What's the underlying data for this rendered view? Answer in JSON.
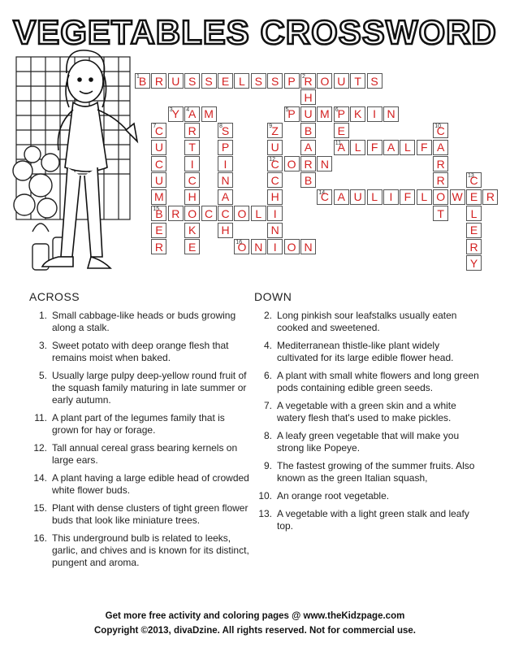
{
  "title": "VEGETABLES CROSSWORD",
  "words": [
    {
      "num": "1",
      "answer": "BRUSSELSSPROUTS",
      "row": 0,
      "col": 0,
      "dir": "across"
    },
    {
      "num": "2",
      "answer": "RHUBARB",
      "row": 0,
      "col": 10,
      "dir": "down"
    },
    {
      "num": "3",
      "answer": "YAM",
      "row": 2,
      "col": 2,
      "dir": "across"
    },
    {
      "num": "4",
      "answer": "ARTICHOKE",
      "row": 2,
      "col": 3,
      "dir": "down"
    },
    {
      "num": "5",
      "answer": "PUMPKIN",
      "row": 2,
      "col": 9,
      "dir": "across"
    },
    {
      "num": "6",
      "answer": "PEA",
      "row": 2,
      "col": 12,
      "dir": "down"
    },
    {
      "num": "7",
      "answer": "CUCUMBER",
      "row": 3,
      "col": 1,
      "dir": "down"
    },
    {
      "num": "8",
      "answer": "SPINACH",
      "row": 3,
      "col": 5,
      "dir": "down"
    },
    {
      "num": "9",
      "answer": "ZUCCHINI",
      "row": 3,
      "col": 8,
      "dir": "down"
    },
    {
      "num": "10",
      "answer": "CARROT",
      "row": 3,
      "col": 18,
      "dir": "down"
    },
    {
      "num": "11",
      "answer": "ALFALFA",
      "row": 4,
      "col": 12,
      "dir": "across"
    },
    {
      "num": "12",
      "answer": "CORN",
      "row": 5,
      "col": 8,
      "dir": "across"
    },
    {
      "num": "13",
      "answer": "CELERY",
      "row": 6,
      "col": 20,
      "dir": "down"
    },
    {
      "num": "14",
      "answer": "CAULIFLOWER",
      "row": 7,
      "col": 11,
      "dir": "across"
    },
    {
      "num": "15",
      "answer": "BROCCOLI",
      "row": 8,
      "col": 1,
      "dir": "across"
    },
    {
      "num": "16",
      "answer": "ONION",
      "row": 10,
      "col": 6,
      "dir": "across"
    }
  ],
  "across_heading": "ACROSS",
  "down_heading": "DOWN",
  "across": [
    {
      "num": "1.",
      "text": "Small cabbage-like heads or buds growing along a stalk."
    },
    {
      "num": "3.",
      "text": "Sweet potato with deep orange flesh that remains moist when baked."
    },
    {
      "num": "5.",
      "text": "Usually large pulpy deep-yellow round fruit of the squash family maturing in late summer or early autumn."
    },
    {
      "num": "11.",
      "text": "A plant part of the legumes family that is grown for hay or forage."
    },
    {
      "num": "12.",
      "text": "Tall annual cereal grass bearing kernels on large ears."
    },
    {
      "num": "14.",
      "text": "A plant having a large edible head of crowded white flower buds."
    },
    {
      "num": "15.",
      "text": "Plant with dense clusters of tight green flower buds that look like miniature trees."
    },
    {
      "num": "16.",
      "text": "This underground bulb is related to leeks, garlic, and chives and is known for its distinct, pungent and aroma."
    }
  ],
  "down": [
    {
      "num": "2.",
      "text": "Long pinkish sour leafstalks usually eaten cooked and sweetened."
    },
    {
      "num": "4.",
      "text": "Mediterranean thistle-like plant widely cultivated for its large edible flower head."
    },
    {
      "num": "6.",
      "text": "A plant with small white flowers and long green pods containing edible green seeds."
    },
    {
      "num": "7.",
      "text": "A vegetable with a green skin and a white watery flesh that's used to make pickles."
    },
    {
      "num": "8.",
      "text": "A leafy green vegetable that will make you strong like Popeye."
    },
    {
      "num": "9.",
      "text": "The fastest growing of the summer fruits. Also known as the green Italian squash,"
    },
    {
      "num": "10.",
      "text": "An orange root vegetable."
    },
    {
      "num": "13.",
      "text": "A vegetable with a light green stalk and leafy top."
    }
  ],
  "footer": {
    "line1": "Get more free activity and coloring pages @ www.theKidzpage.com",
    "line2": "Copyright ©2013, divaDzine.  All rights reserved.  Not for commercial use."
  }
}
